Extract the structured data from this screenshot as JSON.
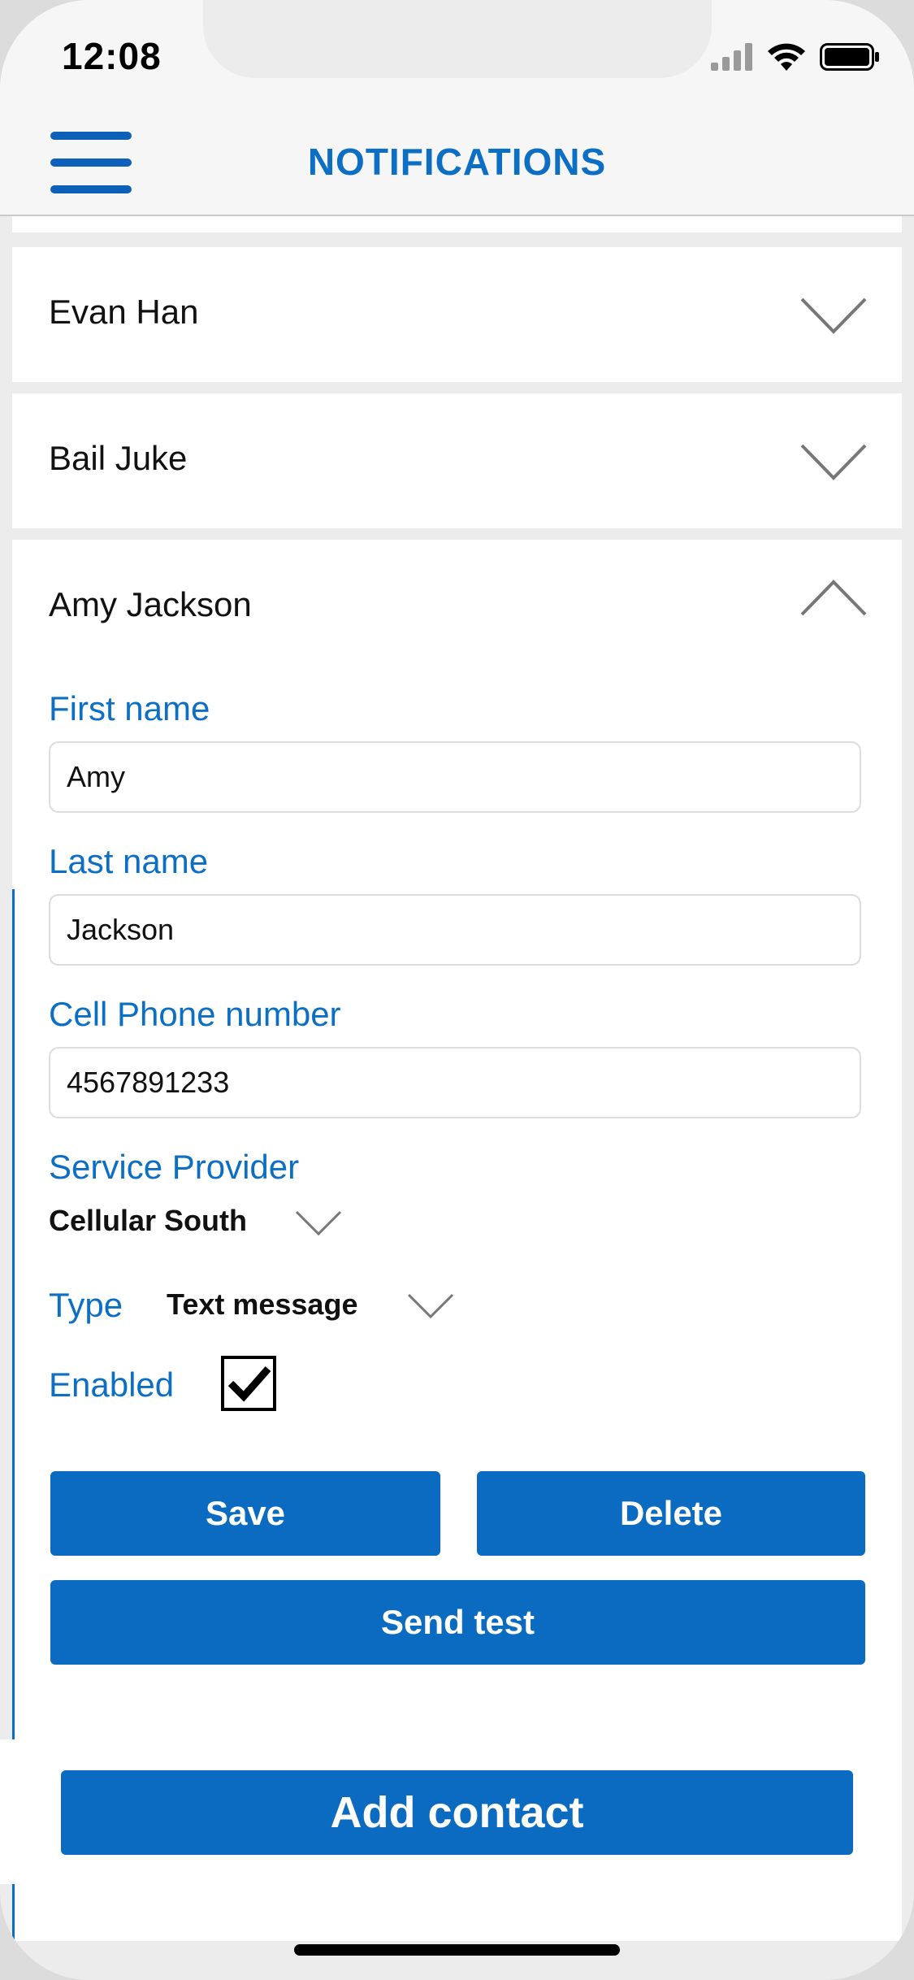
{
  "status_bar": {
    "time": "12:08"
  },
  "header": {
    "title": "NOTIFICATIONS"
  },
  "contacts": [
    {
      "name": "Evan Han",
      "expanded": false
    },
    {
      "name": "Bail Juke",
      "expanded": false
    },
    {
      "name": "Amy Jackson",
      "expanded": true
    }
  ],
  "form": {
    "first_name_label": "First name",
    "first_name_value": "Amy",
    "last_name_label": "Last name",
    "last_name_value": "Jackson",
    "phone_label": "Cell Phone number",
    "phone_value": "4567891233",
    "provider_label": "Service Provider",
    "provider_value": "Cellular South",
    "type_label": "Type",
    "type_value": "Text message",
    "enabled_label": "Enabled",
    "enabled": true,
    "save_label": "Save",
    "delete_label": "Delete",
    "send_test_label": "Send test"
  },
  "footer": {
    "add_contact_label": "Add contact"
  },
  "colors": {
    "accent": "#0c6fc4",
    "button": "#0a6bc0",
    "background": "#ececec"
  }
}
